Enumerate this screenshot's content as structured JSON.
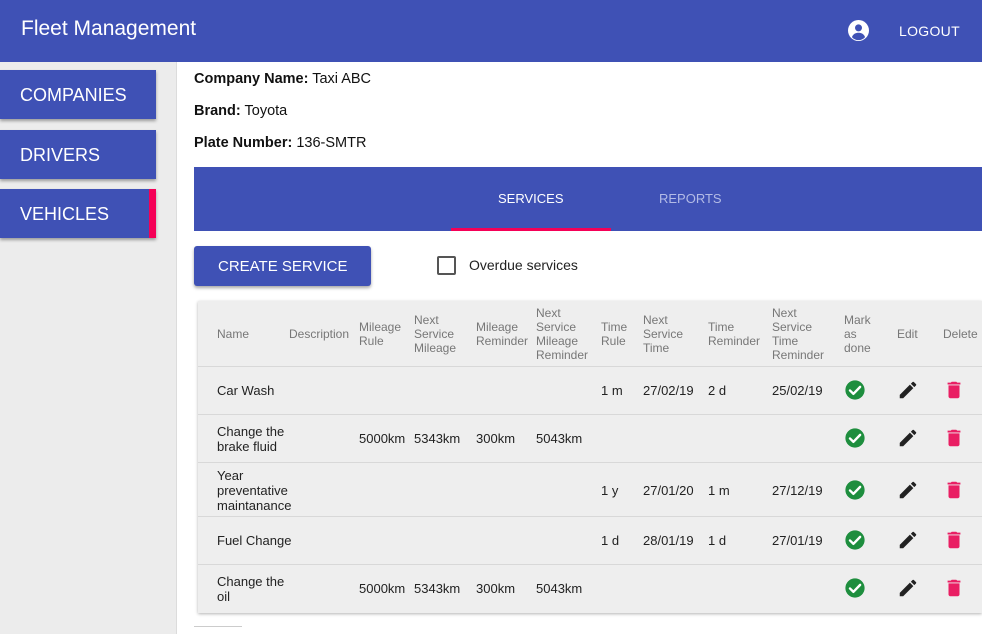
{
  "app": {
    "title": "Fleet Management",
    "logout_label": "LOGOUT",
    "account_icon": "account-circle-icon"
  },
  "sidebar": {
    "items": [
      {
        "label": "COMPANIES",
        "active": false
      },
      {
        "label": "DRIVERS",
        "active": false
      },
      {
        "label": "VEHICLES",
        "active": true
      }
    ]
  },
  "vehicle": {
    "company_label": "Company Name:",
    "company_value": "Taxi ABC",
    "brand_label": "Brand:",
    "brand_value": "Toyota",
    "plate_label": "Plate Number:",
    "plate_value": "136-SMTR"
  },
  "tabs": [
    {
      "label": "SERVICES",
      "active": true
    },
    {
      "label": "REPORTS",
      "active": false
    }
  ],
  "toolbar": {
    "create_label": "CREATE SERVICE",
    "overdue_label": "Overdue services",
    "overdue_checked": false
  },
  "table": {
    "headers": {
      "name": "Name",
      "description": "Description",
      "mileage_rule": [
        "Mileage",
        "Rule"
      ],
      "next_service_mileage": [
        "Next",
        "Service",
        "Mileage"
      ],
      "mileage_reminder": [
        "Mileage",
        "Reminder"
      ],
      "next_service_mileage_reminder": [
        "Next",
        "Service",
        "Mileage",
        "Reminder"
      ],
      "time_rule": [
        "Time",
        "Rule"
      ],
      "next_service_time": [
        "Next",
        "Service",
        "Time"
      ],
      "time_reminder": [
        "Time",
        "Reminder"
      ],
      "next_service_time_reminder": [
        "Next",
        "Service",
        "Time",
        "Reminder"
      ],
      "mark_done": [
        "Mark",
        "as",
        "done"
      ],
      "edit": "Edit",
      "delete": "Delete"
    },
    "rows": [
      {
        "name": [
          "Car Wash"
        ],
        "description": "",
        "mileage_rule": "",
        "next_mileage": "",
        "mileage_reminder": "",
        "next_mileage_reminder": "",
        "time_rule": "1 m",
        "next_time": "27/02/19",
        "time_reminder": "2 d",
        "next_time_reminder": "25/02/19"
      },
      {
        "name": [
          "Change the",
          "brake fluid"
        ],
        "description": "",
        "mileage_rule": "5000km",
        "next_mileage": "5343km",
        "mileage_reminder": "300km",
        "next_mileage_reminder": "5043km",
        "time_rule": "",
        "next_time": "",
        "time_reminder": "",
        "next_time_reminder": ""
      },
      {
        "name": [
          "Year",
          "preventative",
          "maintanance"
        ],
        "description": "",
        "mileage_rule": "",
        "next_mileage": "",
        "mileage_reminder": "",
        "next_mileage_reminder": "",
        "time_rule": "1 y",
        "next_time": "27/01/20",
        "time_reminder": "1 m",
        "next_time_reminder": "27/12/19"
      },
      {
        "name": [
          "Fuel Change"
        ],
        "description": "",
        "mileage_rule": "",
        "next_mileage": "",
        "mileage_reminder": "",
        "next_mileage_reminder": "",
        "time_rule": "1 d",
        "next_time": "28/01/19",
        "time_reminder": "1 d",
        "next_time_reminder": "27/01/19"
      },
      {
        "name": [
          "Change the",
          "oil"
        ],
        "description": "",
        "mileage_rule": "5000km",
        "next_mileage": "5343km",
        "mileage_reminder": "300km",
        "next_mileage_reminder": "5043km",
        "time_rule": "",
        "next_time": "",
        "time_reminder": "",
        "next_time_reminder": ""
      }
    ]
  },
  "colors": {
    "primary": "#3f51b5",
    "accent": "#f50057",
    "success": "#1e8e3e",
    "delete": "#e91e63"
  }
}
